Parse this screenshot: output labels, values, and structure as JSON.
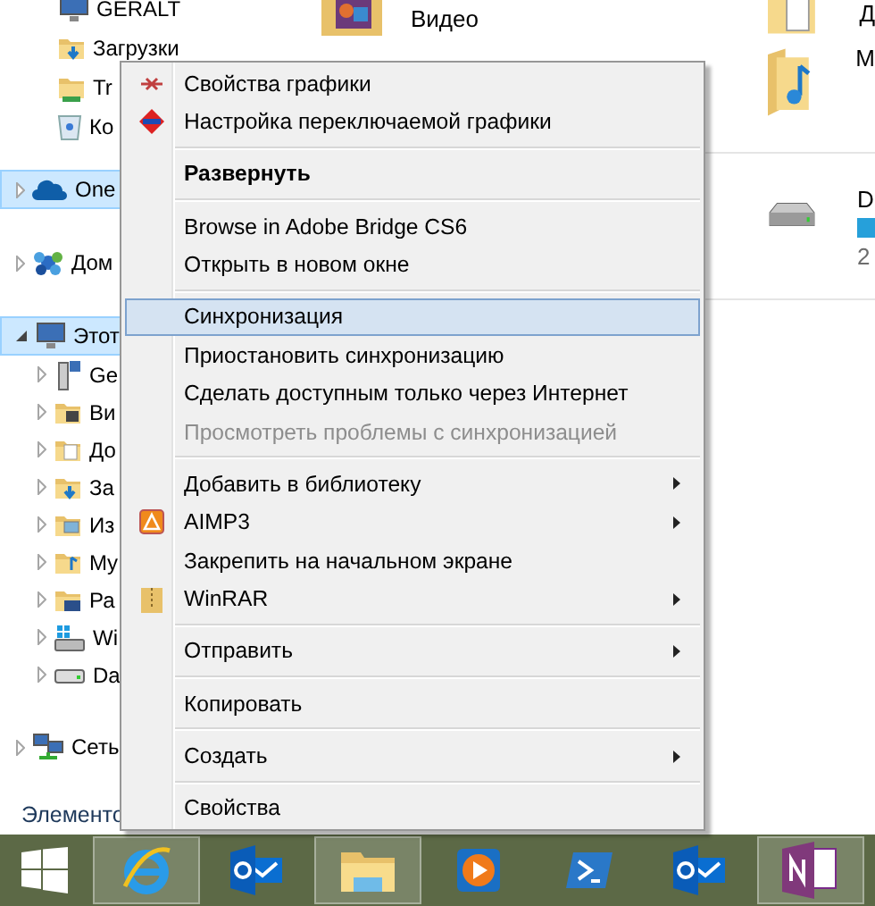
{
  "navigation_pane": {
    "groups": [
      {
        "items": [
          {
            "label": "GERALT",
            "kind": "computer",
            "selected": false
          },
          {
            "label": "Загрузки",
            "kind": "downloads",
            "selected": false
          },
          {
            "label": "Tr",
            "kind": "shared-folder",
            "selected": false
          },
          {
            "label": "Ко",
            "kind": "recycle",
            "selected": false
          }
        ]
      },
      {
        "items": [
          {
            "label": "One",
            "kind": "cloud",
            "selected": true,
            "expanded": false
          }
        ]
      },
      {
        "items": [
          {
            "label": "Дом",
            "kind": "homegroup",
            "selected": false,
            "expanded": false
          }
        ]
      },
      {
        "items": [
          {
            "label": "Этот",
            "kind": "computer",
            "selected": true,
            "expanded": true,
            "children": [
              {
                "label": "Ge",
                "kind": "network-drive",
                "selected": false,
                "expanded": false
              },
              {
                "label": "Ви",
                "kind": "video",
                "selected": false,
                "expanded": false
              },
              {
                "label": "До",
                "kind": "documents",
                "selected": false,
                "expanded": false
              },
              {
                "label": "За",
                "kind": "downloads",
                "selected": false,
                "expanded": false
              },
              {
                "label": "Из",
                "kind": "pictures",
                "selected": false,
                "expanded": false
              },
              {
                "label": "My",
                "kind": "music",
                "selected": false,
                "expanded": false
              },
              {
                "label": "Ра",
                "kind": "desktop",
                "selected": false,
                "expanded": false
              },
              {
                "label": "Wi",
                "kind": "system-drive",
                "selected": false,
                "expanded": false
              },
              {
                "label": "Da",
                "kind": "drive",
                "selected": false,
                "expanded": false
              }
            ]
          }
        ]
      },
      {
        "items": [
          {
            "label": "Сеть",
            "kind": "network",
            "selected": false,
            "expanded": false
          }
        ]
      }
    ]
  },
  "content_pane": {
    "rows": [
      {
        "kind": "items",
        "left": {
          "label": "Видео",
          "kind": "video"
        },
        "right": {
          "label": "Д",
          "kind": "documents"
        }
      },
      {
        "kind": "items",
        "right": {
          "label": "М",
          "kind": "music"
        }
      },
      {
        "kind": "divider"
      },
      {
        "kind": "items",
        "right": {
          "label": "D",
          "kind": "drive",
          "detail": "2"
        }
      },
      {
        "kind": "divider"
      }
    ]
  },
  "status_bar": {
    "text": "Элементо"
  },
  "context_menu": {
    "sections": [
      [
        {
          "label": "Свойства графики",
          "default": false,
          "selected": false,
          "disabled": false,
          "submenu": false
        },
        {
          "label": "Настройка переключаемой графики",
          "default": false,
          "selected": false,
          "disabled": false,
          "submenu": false
        }
      ],
      [
        {
          "label": "Развернуть",
          "default": true,
          "selected": false,
          "disabled": false,
          "submenu": false
        }
      ],
      [
        {
          "label": "Browse in Adobe Bridge CS6",
          "default": false,
          "selected": false,
          "disabled": false,
          "submenu": false
        },
        {
          "label": "Открыть в новом окне",
          "default": false,
          "selected": false,
          "disabled": false,
          "submenu": false
        }
      ],
      [
        {
          "label": "Синхронизация",
          "default": false,
          "selected": true,
          "disabled": false,
          "submenu": false
        },
        {
          "label": "Приостановить синхронизацию",
          "default": false,
          "selected": false,
          "disabled": false,
          "submenu": false
        },
        {
          "label": "Сделать доступным только через Интернет",
          "default": false,
          "selected": false,
          "disabled": false,
          "submenu": false
        },
        {
          "label": "Просмотреть проблемы с синхронизацией",
          "default": false,
          "selected": false,
          "disabled": true,
          "submenu": false
        }
      ],
      [
        {
          "label": "Добавить в библиотеку",
          "default": false,
          "selected": false,
          "disabled": false,
          "submenu": true
        },
        {
          "label": "AIMP3",
          "default": false,
          "selected": false,
          "disabled": false,
          "submenu": true
        },
        {
          "label": "Закрепить на начальном экране",
          "default": false,
          "selected": false,
          "disabled": false,
          "submenu": false
        },
        {
          "label": "WinRAR",
          "default": false,
          "selected": false,
          "disabled": false,
          "submenu": true
        }
      ],
      [
        {
          "label": "Отправить",
          "default": false,
          "selected": false,
          "disabled": false,
          "submenu": true
        }
      ],
      [
        {
          "label": "Копировать",
          "default": false,
          "selected": false,
          "disabled": false,
          "submenu": false
        }
      ],
      [
        {
          "label": "Создать",
          "default": false,
          "selected": false,
          "disabled": false,
          "submenu": true
        }
      ],
      [
        {
          "label": "Свойства",
          "default": false,
          "selected": false,
          "disabled": false,
          "submenu": false
        }
      ]
    ]
  },
  "taskbar": {
    "buttons": [
      {
        "kind": "browser",
        "active": true
      },
      {
        "kind": "mail",
        "active": false
      },
      {
        "kind": "explorer",
        "active": true
      },
      {
        "kind": "media-player",
        "active": false
      },
      {
        "kind": "shell",
        "active": false
      },
      {
        "kind": "mail",
        "active": false
      },
      {
        "kind": "notes",
        "active": true
      }
    ]
  }
}
